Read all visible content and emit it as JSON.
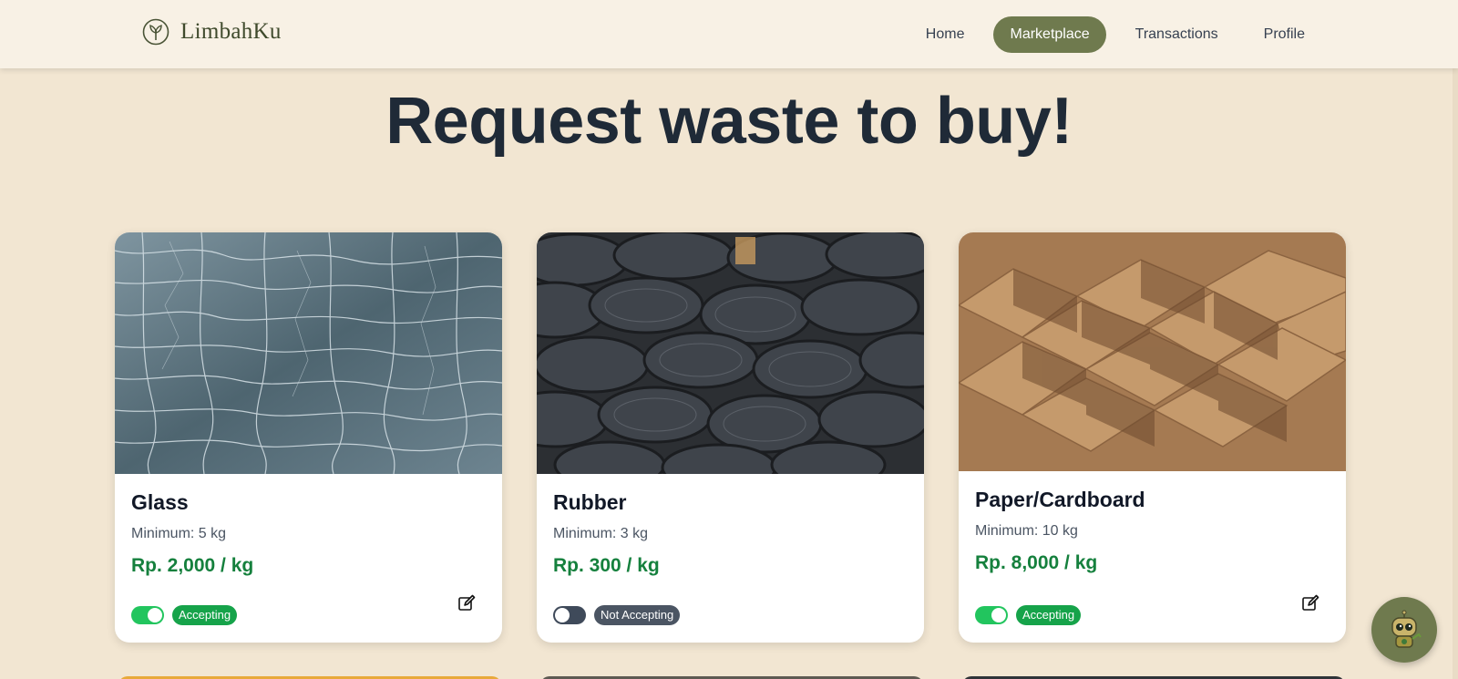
{
  "header": {
    "brand": "LimbahKu",
    "nav": [
      {
        "label": "Home",
        "active": false
      },
      {
        "label": "Marketplace",
        "active": true
      },
      {
        "label": "Transactions",
        "active": false
      },
      {
        "label": "Profile",
        "active": false
      }
    ]
  },
  "page": {
    "heading": "Request waste to buy!"
  },
  "cards": [
    {
      "title": "Glass",
      "minimum": "Minimum: 5 kg",
      "price": "Rp. 2,000 / kg",
      "accepting": true,
      "status": "Accepting",
      "image": "cracked-glass-photo",
      "editable": true
    },
    {
      "title": "Rubber",
      "minimum": "Minimum: 3 kg",
      "price": "Rp. 300 / kg",
      "accepting": false,
      "status": "Not Accepting",
      "image": "stacked-tires-photo",
      "editable": false
    },
    {
      "title": "Paper/Cardboard",
      "minimum": "Minimum: 10 kg",
      "price": "Rp. 8,000 / kg",
      "accepting": true,
      "status": "Accepting",
      "image": "cardboard-dividers-photo",
      "editable": true
    }
  ],
  "colors": {
    "background": "#f2e6d2",
    "header": "#f8f1e5",
    "accent": "#6f7a4e",
    "price": "#15803d",
    "accepting": "#16a34a",
    "not_accepting": "#4b5563"
  },
  "icons": {
    "brand": "leaf-icon",
    "edit": "edit-icon",
    "chatbot": "robot-icon"
  }
}
